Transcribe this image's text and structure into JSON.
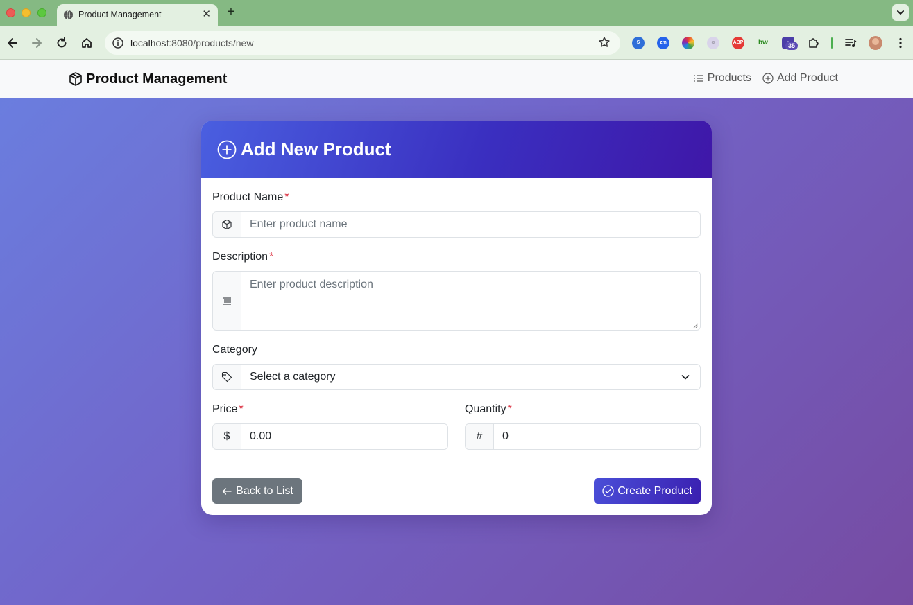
{
  "browser": {
    "tab_title": "Product Management",
    "tab_close": "✕",
    "new_tab": "+",
    "url_host": "localhost",
    "url_path": ":8080/products/new",
    "extension_badge": "35",
    "ext_labels": [
      "zm",
      "ABP",
      "bw"
    ]
  },
  "navbar": {
    "brand": "Product Management",
    "links": [
      {
        "label": "Products",
        "icon": "list-icon"
      },
      {
        "label": "Add Product",
        "icon": "plus-circle-icon"
      }
    ]
  },
  "form": {
    "title": "Add New Product",
    "required_mark": "*",
    "product_name": {
      "label": "Product Name",
      "placeholder": "Enter product name",
      "value": ""
    },
    "description": {
      "label": "Description",
      "placeholder": "Enter product description",
      "value": ""
    },
    "category": {
      "label": "Category",
      "selected": "Select a category"
    },
    "price": {
      "label": "Price",
      "addon": "$",
      "value": "0.00"
    },
    "quantity": {
      "label": "Quantity",
      "addon": "#",
      "value": "0"
    },
    "back_button": "Back to List",
    "submit_button": "Create Product"
  },
  "colors": {
    "accent": "#4a4fd8",
    "secondary_button": "#6c757d",
    "required": "#dc3545",
    "browser_frame": "#85b983"
  }
}
